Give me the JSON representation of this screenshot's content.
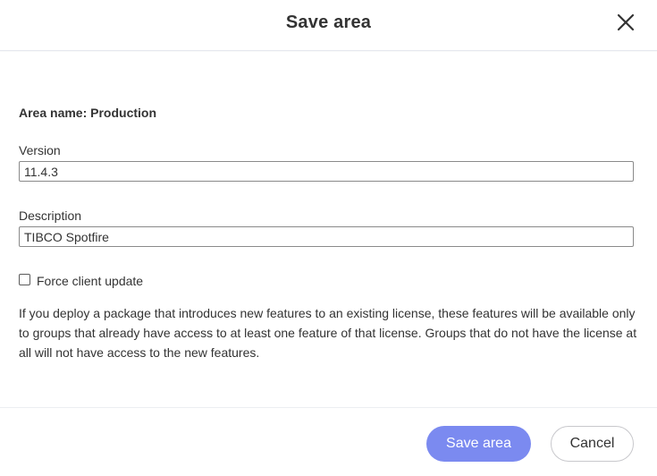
{
  "dialog": {
    "title": "Save area",
    "close_icon": "close-icon"
  },
  "form": {
    "area_name": "Area name: Production",
    "version": {
      "label": "Version",
      "value": "11.4.3"
    },
    "description": {
      "label": "Description",
      "value": "TIBCO Spotfire"
    },
    "force_client_update": {
      "label": "Force client update",
      "checked": false
    },
    "info_text": "If you deploy a package that introduces new features to an existing license, these features will be available only to groups that already have access to at least one feature of that license. Groups that do not have the license at all will not have access to the new features."
  },
  "footer": {
    "save_label": "Save area",
    "cancel_label": "Cancel"
  },
  "colors": {
    "primary_button": "#7b8af0",
    "text": "#333333"
  }
}
